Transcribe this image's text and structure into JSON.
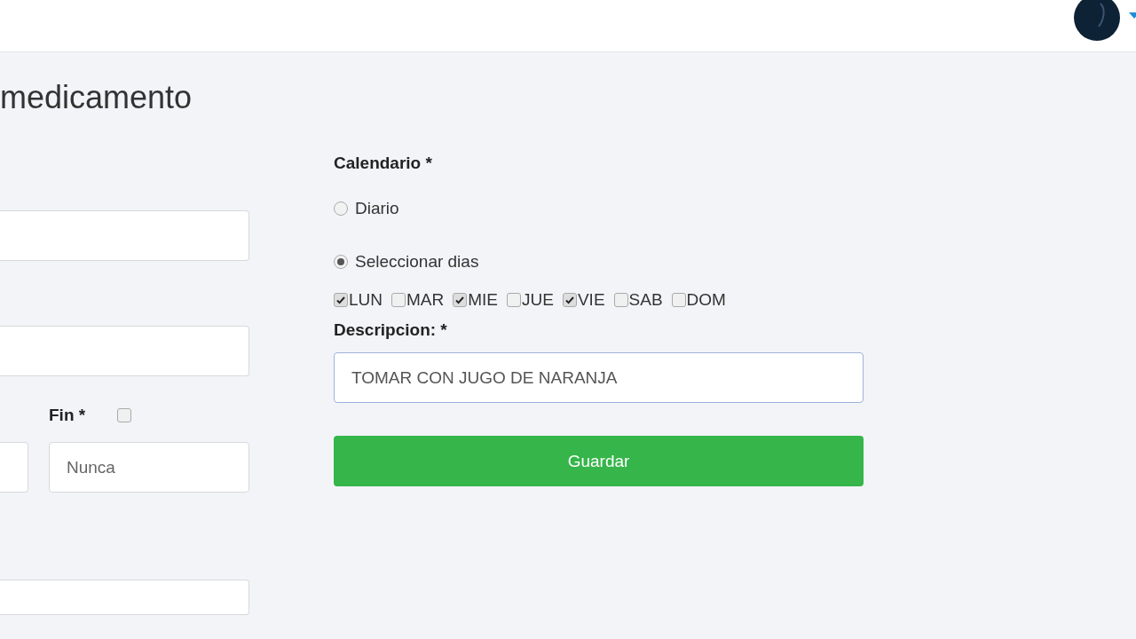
{
  "page_title": "medicamento",
  "end": {
    "label": "Fin *",
    "checked": false,
    "placeholder": "Nunca"
  },
  "calendar": {
    "label": "Calendario *",
    "options": [
      {
        "label": "Diario",
        "selected": false
      },
      {
        "label": "Seleccionar dias",
        "selected": true
      }
    ],
    "days": [
      {
        "label": "LUN",
        "checked": true
      },
      {
        "label": "MAR",
        "checked": false
      },
      {
        "label": "MIE",
        "checked": true
      },
      {
        "label": "JUE",
        "checked": false
      },
      {
        "label": "VIE",
        "checked": true
      },
      {
        "label": "SAB",
        "checked": false
      },
      {
        "label": "DOM",
        "checked": false
      }
    ]
  },
  "description": {
    "label": "Descripcion: *",
    "value": "TOMAR CON JUGO DE NARANJA"
  },
  "save_button": "Guardar"
}
